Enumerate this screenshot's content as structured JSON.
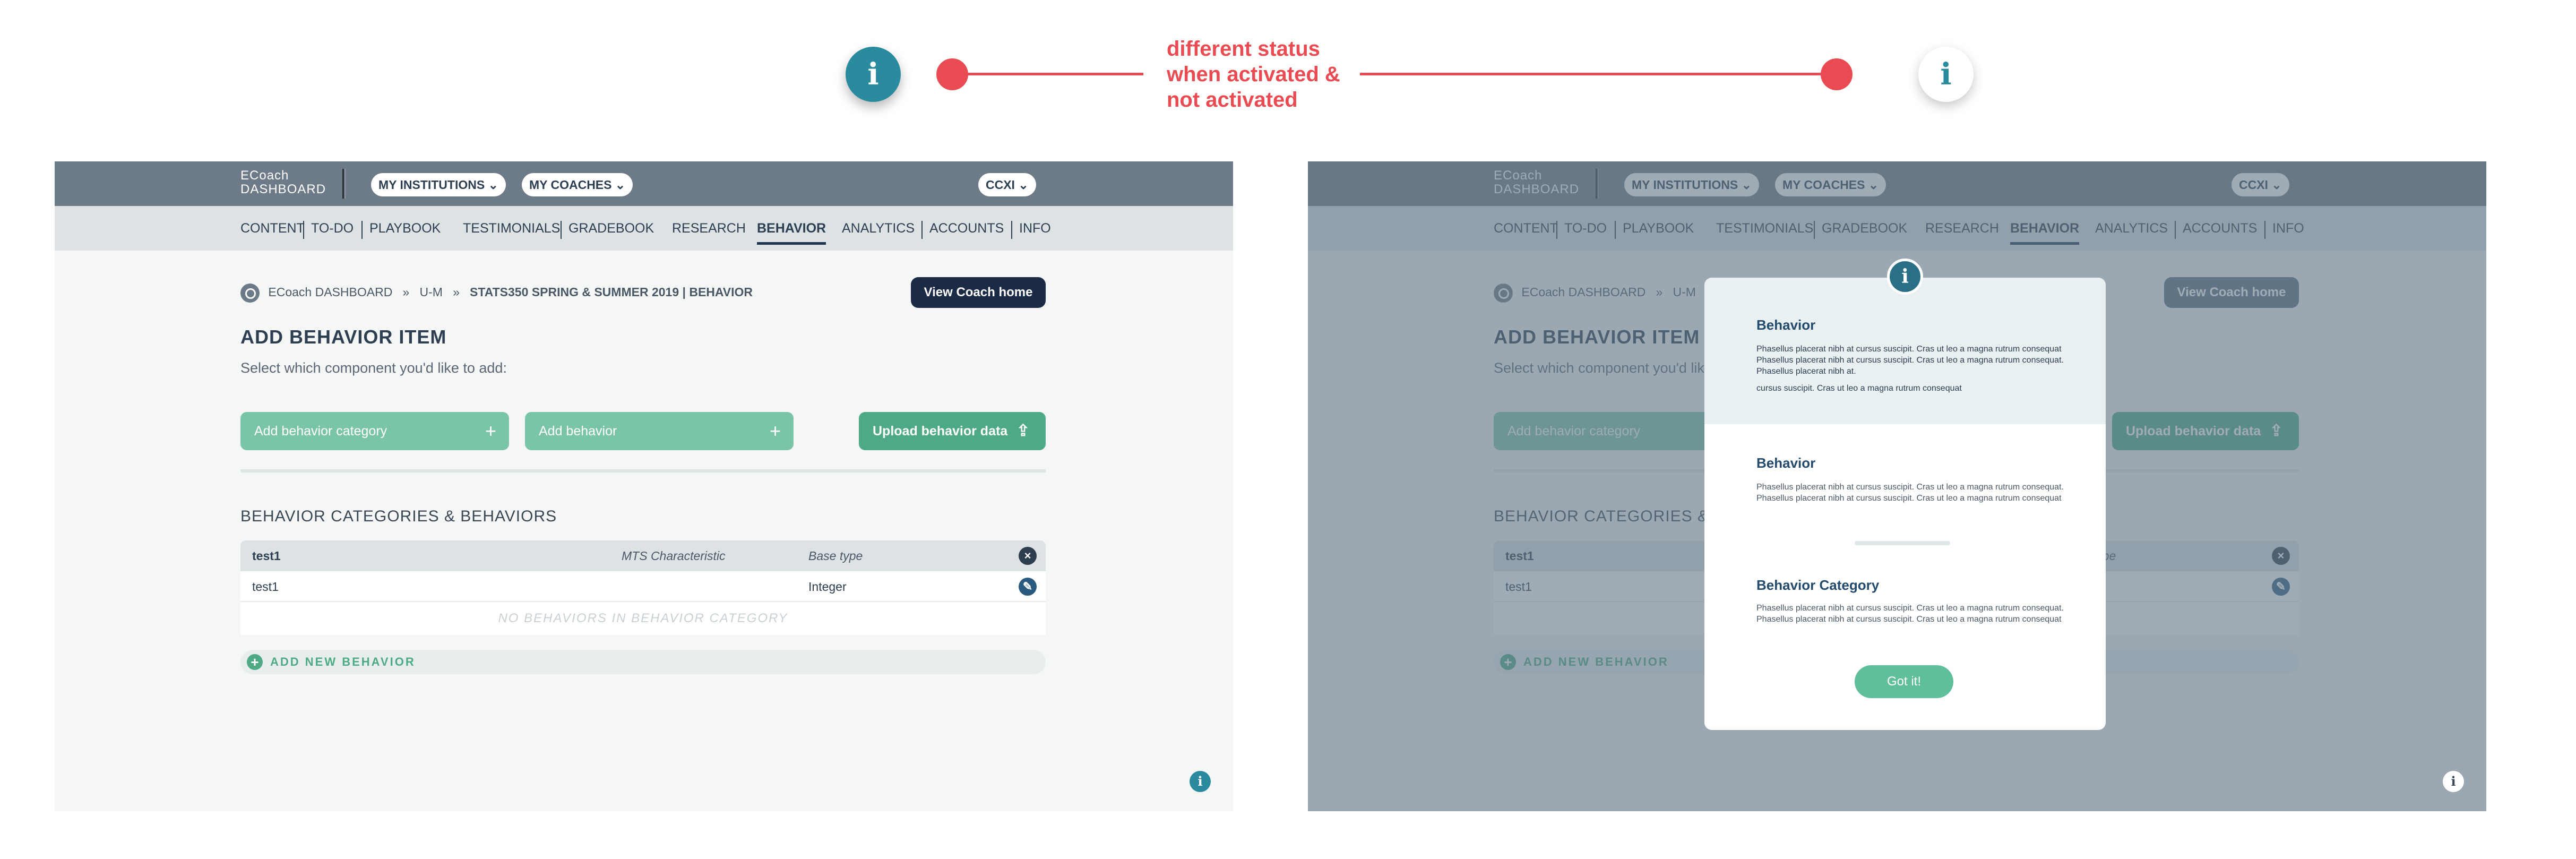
{
  "annotation": {
    "line1": "different status",
    "line2": "when activated &",
    "line3": "not activated",
    "accent_color": "#e84c52",
    "info_icon_active": "info-icon-teal-filled",
    "info_icon_inactive": "info-icon-white"
  },
  "app": {
    "brand_line1": "ECoach",
    "brand_line2": "DASHBOARD",
    "institutions": "MY INSTITUTIONS",
    "coaches": "MY COACHES",
    "user": "CCXI",
    "nav": [
      "CONTENT",
      "TO-DO",
      "PLAYBOOK",
      "TESTIMONIALS",
      "GRADEBOOK",
      "RESEARCH",
      "BEHAVIOR",
      "ANALYTICS",
      "ACCOUNTS",
      "INFO"
    ],
    "active_nav": "BEHAVIOR",
    "breadcrumb": {
      "home": "ECoach DASHBOARD",
      "sep": "»",
      "level1": "U-M",
      "level2": "STATS350 SPRING & SUMMER 2019 | BEHAVIOR"
    },
    "view_coach_home": "View Coach home",
    "heading": "ADD BEHAVIOR ITEM",
    "subheading": "Select which component you'd like to add:",
    "btn_add_category": "Add behavior category",
    "btn_add_behavior": "Add behavior",
    "btn_upload": "Upload behavior data",
    "section_title": "BEHAVIOR CATEGORIES & BEHAVIORS",
    "table": {
      "category": "test1",
      "col_mts": "MTS Characteristic",
      "col_base": "Base type",
      "row_name": "test1",
      "row_type": "Integer",
      "empty": "NO BEHAVIORS IN BEHAVIOR CATEGORY"
    },
    "add_new": "ADD NEW BEHAVIOR",
    "colors": {
      "topbar": "#6d7a87",
      "green": "#4eaa84",
      "dark_button": "#1b2a45"
    }
  },
  "modal": {
    "title1": "Behavior",
    "text1a": "Phasellus placerat nibh at cursus suscipit. Cras ut leo a magna rutrum consequat Phasellus placerat nibh at cursus suscipit. Cras ut leo a magna rutrum consequat. Phasellus placerat nibh at.",
    "text1b": "cursus suscipit. Cras ut leo a magna rutrum consequat",
    "title2": "Behavior",
    "text2": "Phasellus placerat nibh at cursus suscipit. Cras ut leo a magna rutrum consequat. Phasellus placerat nibh at cursus suscipit. Cras ut leo a magna rutrum consequat",
    "title3": "Behavior Category",
    "text3": "Phasellus placerat nibh at cursus suscipit. Cras ut leo a magna rutrum consequat. Phasellus placerat nibh at cursus suscipit. Cras ut leo a magna rutrum consequat",
    "button": "Got it!"
  }
}
